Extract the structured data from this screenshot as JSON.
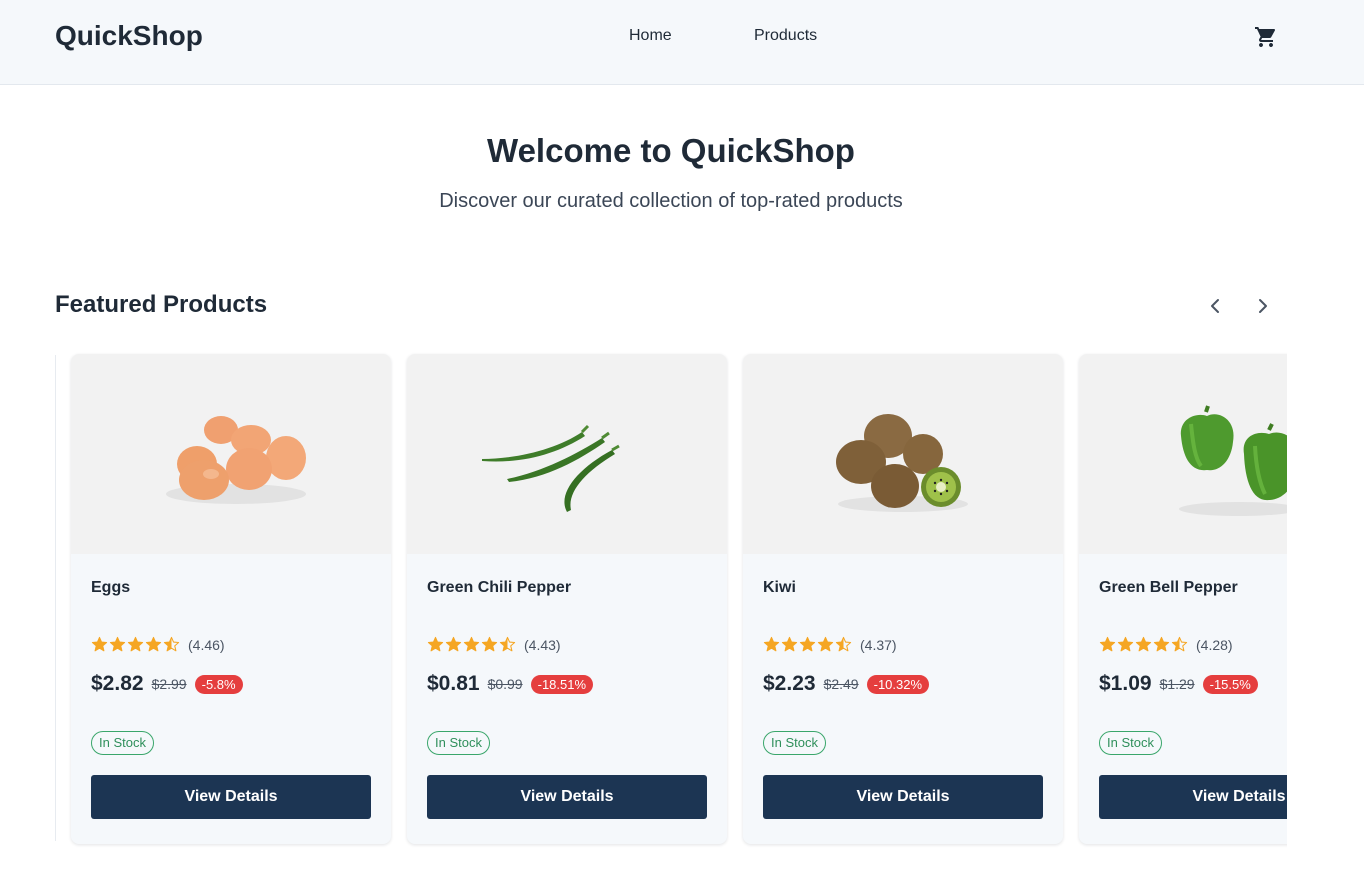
{
  "header": {
    "brand": "QuickShop",
    "nav": [
      {
        "label": "Home"
      },
      {
        "label": "Products"
      }
    ],
    "cart_icon": "shopping-cart-icon"
  },
  "hero": {
    "title": "Welcome to QuickShop",
    "subtitle": "Discover our curated collection of top-rated products"
  },
  "featured": {
    "title": "Featured Products",
    "prev_icon": "chevron-left-icon",
    "next_icon": "chevron-right-icon",
    "products": [
      {
        "name": "Eggs",
        "rating": 4.46,
        "rating_text": "(4.46)",
        "price": "$2.82",
        "old_price": "$2.99",
        "discount": "-5.8%",
        "stock": "In Stock",
        "button": "View Details",
        "image": "eggs-image"
      },
      {
        "name": "Green Chili Pepper",
        "rating": 4.43,
        "rating_text": "(4.43)",
        "price": "$0.81",
        "old_price": "$0.99",
        "discount": "-18.51%",
        "stock": "In Stock",
        "button": "View Details",
        "image": "green-chili-pepper-image"
      },
      {
        "name": "Kiwi",
        "rating": 4.37,
        "rating_text": "(4.37)",
        "price": "$2.23",
        "old_price": "$2.49",
        "discount": "-10.32%",
        "stock": "In Stock",
        "button": "View Details",
        "image": "kiwi-image"
      },
      {
        "name": "Green Bell Pepper",
        "rating": 4.28,
        "rating_text": "(4.28)",
        "price": "$1.09",
        "old_price": "$1.29",
        "discount": "-15.5%",
        "stock": "In Stock",
        "button": "View Details",
        "image": "green-bell-pepper-image"
      }
    ]
  },
  "colors": {
    "header_bg": "#f5f8fb",
    "button_bg": "#1c3553",
    "star": "#f5a623",
    "discount": "#e53e3e",
    "stock": "#2f8f5b"
  }
}
